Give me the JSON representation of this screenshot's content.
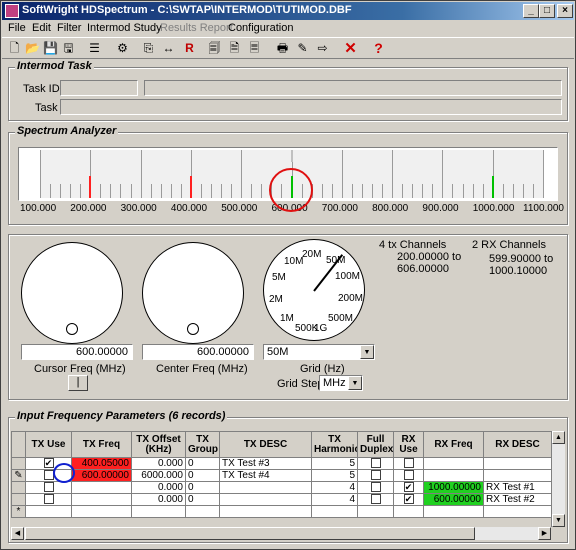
{
  "window": {
    "title": "SoftWright HDSpectrum - C:\\SWTAP\\INTERMOD\\TUTIMOD.DBF"
  },
  "title_buttons": {
    "minimize": "_",
    "maximize": "□",
    "close": "×"
  },
  "menu": [
    "File",
    "Edit",
    "Filter",
    "Intermod Study",
    "Results Report",
    "Configuration"
  ],
  "toolbar_icons": [
    "new-icon",
    "open-icon",
    "save-icon",
    "disk-icon",
    "list-icon",
    "gear-icon",
    "page-arrow-icon",
    "width-arrow-icon",
    "R",
    "print-icon",
    "doc-icon",
    "doc2-icon",
    "printer-icon",
    "edit-icon",
    "export-icon",
    "close-x",
    "help-question"
  ],
  "intermod_task": {
    "label": "Intermod Task",
    "task_id_label": "Task ID:",
    "task_label": "Task",
    "task_id_value": "",
    "task_value": ""
  },
  "spectrum": {
    "label": "Spectrum Analyzer",
    "ticks": [
      "100.000",
      "200.000",
      "300.000",
      "400.000",
      "500.000",
      "600.000",
      "700.000",
      "800.000",
      "900.000",
      "1000.000",
      "1100.000"
    ],
    "lines": [
      {
        "freq": 200,
        "color": "#ff2020"
      },
      {
        "freq": 400,
        "color": "#ff2020"
      },
      {
        "freq": 600,
        "color": "#00c000"
      },
      {
        "freq": 1000,
        "color": "#00c000"
      }
    ],
    "range": [
      100,
      1100
    ]
  },
  "controls": {
    "cursor_freq": "600.00000",
    "cursor_label": "Cursor Freq (MHz)",
    "center_freq": "600.00000",
    "center_label": "Center Freq (MHz)",
    "grid_value": "50M",
    "grid_label": "Grid (Hz)",
    "grid_step_label": "Grid Step",
    "grid_step_value": "MHz",
    "dial_labels": [
      "20M",
      "50M",
      "10M",
      "100M",
      "5M",
      "200M",
      "2M",
      "500M",
      "1M",
      "1G",
      "500K"
    ],
    "tx_channels": "4 tx Channels",
    "tx_from": "200.00000 to",
    "tx_to": "606.00000",
    "rx_channels": "2 RX Channels",
    "rx_from": "599.90000 to",
    "rx_to": "1000.10000",
    "small_button": "|"
  },
  "table": {
    "label": "Input Frequency Parameters (6 records)",
    "headers": [
      "TX Use",
      "TX Freq",
      "TX Offset (KHz)",
      "TX Group",
      "TX DESC",
      "TX Harmonic",
      "Full Duplex",
      "RX Use",
      "RX Freq",
      "RX DESC"
    ],
    "rows": [
      {
        "marker": "",
        "tx_use": true,
        "tx_freq": "400.05000",
        "tx_offset": "0.000",
        "tx_group": "0",
        "tx_desc": "TX Test #3",
        "tx_harm": "5",
        "full_duplex": false,
        "rx_use": false,
        "rx_freq": "",
        "rx_desc": ""
      },
      {
        "marker": "✎",
        "tx_use": false,
        "tx_freq": "600.00000",
        "tx_offset": "6000.000",
        "tx_group": "0",
        "tx_desc": "TX Test #4",
        "tx_harm": "5",
        "full_duplex": false,
        "rx_use": false,
        "rx_freq": "",
        "rx_desc": ""
      },
      {
        "marker": "",
        "tx_use": false,
        "tx_freq": "",
        "tx_offset": "0.000",
        "tx_group": "0",
        "tx_desc": "",
        "tx_harm": "4",
        "full_duplex": false,
        "rx_use": true,
        "rx_freq": "1000.00000",
        "rx_desc": "RX Test #1"
      },
      {
        "marker": "",
        "tx_use": false,
        "tx_freq": "",
        "tx_offset": "0.000",
        "tx_group": "0",
        "tx_desc": "",
        "tx_harm": "4",
        "full_duplex": false,
        "rx_use": true,
        "rx_freq": "600.00000",
        "rx_desc": "RX Test #2"
      },
      {
        "marker": "*",
        "tx_use": null,
        "tx_freq": "",
        "tx_offset": "",
        "tx_group": "",
        "tx_desc": "",
        "tx_harm": "",
        "full_duplex": null,
        "rx_use": null,
        "rx_freq": "",
        "rx_desc": ""
      }
    ]
  },
  "colors": {
    "tx_highlight": "#ff2020",
    "rx_highlight": "#20d020",
    "annotation": "#e01010",
    "annotation_blue": "#1020d0"
  }
}
